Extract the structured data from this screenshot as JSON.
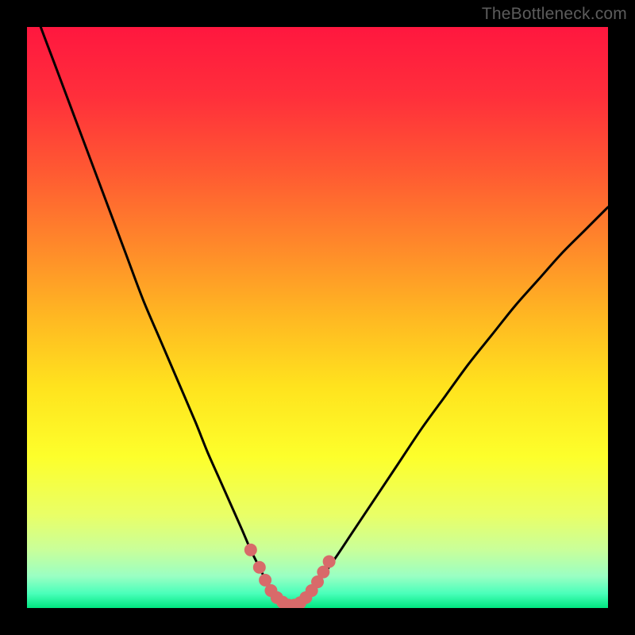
{
  "watermark": "TheBottleneck.com",
  "chart_data": {
    "type": "line",
    "title": "",
    "xlabel": "",
    "ylabel": "",
    "xlim": [
      0,
      100
    ],
    "ylim": [
      0,
      100
    ],
    "background_gradient_stops": [
      {
        "pos": 0.0,
        "color": "#ff173f"
      },
      {
        "pos": 0.12,
        "color": "#ff2f3b"
      },
      {
        "pos": 0.25,
        "color": "#ff5a32"
      },
      {
        "pos": 0.38,
        "color": "#ff8a2a"
      },
      {
        "pos": 0.5,
        "color": "#ffb822"
      },
      {
        "pos": 0.62,
        "color": "#ffe31e"
      },
      {
        "pos": 0.74,
        "color": "#fdff2b"
      },
      {
        "pos": 0.84,
        "color": "#e9ff67"
      },
      {
        "pos": 0.9,
        "color": "#c9ff9a"
      },
      {
        "pos": 0.945,
        "color": "#9affc3"
      },
      {
        "pos": 0.975,
        "color": "#4affba"
      },
      {
        "pos": 1.0,
        "color": "#00e680"
      }
    ],
    "series": [
      {
        "name": "bottleneck-curve",
        "x": [
          0,
          2,
          5,
          8,
          11,
          14,
          17,
          20,
          23,
          26,
          29,
          31,
          33,
          35,
          37,
          38.5,
          40,
          41,
          42,
          43,
          44,
          45,
          46,
          47,
          48,
          50,
          53,
          56,
          60,
          64,
          68,
          72,
          76,
          80,
          84,
          88,
          92,
          96,
          100
        ],
        "y": [
          107,
          101,
          93,
          85,
          77,
          69,
          61,
          53,
          46,
          39,
          32,
          27,
          22.5,
          18,
          13.5,
          10,
          7,
          5,
          3.4,
          2.1,
          1.2,
          0.5,
          0.5,
          1.1,
          2,
          4.3,
          8.5,
          13,
          19,
          25,
          31,
          36.5,
          42,
          47,
          52,
          56.5,
          61,
          65,
          69
        ]
      }
    ],
    "valley_markers": {
      "name": "valley-dots",
      "color": "#d86a6a",
      "radius_px": 8,
      "points": [
        {
          "x": 38.5,
          "y": 10.0
        },
        {
          "x": 40.0,
          "y": 7.0
        },
        {
          "x": 41.0,
          "y": 4.8
        },
        {
          "x": 42.0,
          "y": 3.0
        },
        {
          "x": 43.0,
          "y": 1.8
        },
        {
          "x": 44.0,
          "y": 1.0
        },
        {
          "x": 45.0,
          "y": 0.5
        },
        {
          "x": 46.0,
          "y": 0.5
        },
        {
          "x": 47.0,
          "y": 0.9
        },
        {
          "x": 48.0,
          "y": 1.8
        },
        {
          "x": 49.0,
          "y": 3.0
        },
        {
          "x": 50.0,
          "y": 4.5
        },
        {
          "x": 51.0,
          "y": 6.2
        },
        {
          "x": 52.0,
          "y": 8.0
        }
      ]
    }
  }
}
